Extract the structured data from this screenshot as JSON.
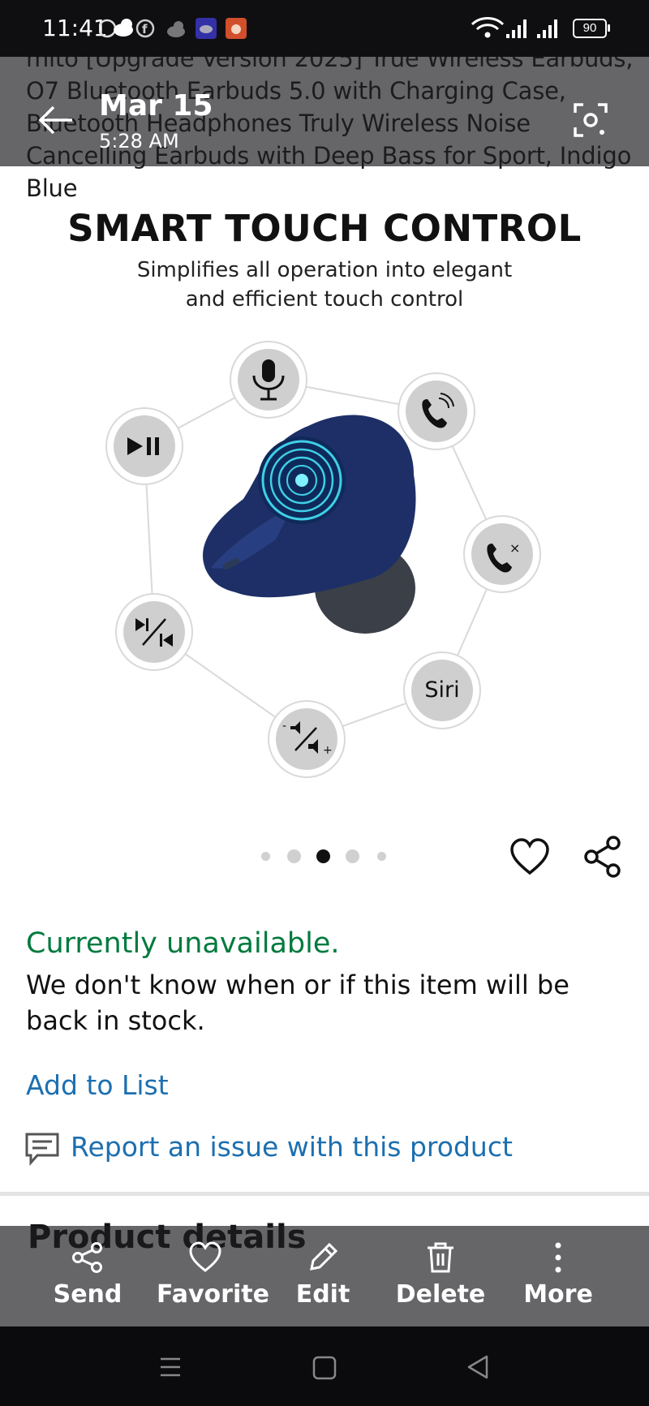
{
  "status_bar": {
    "time": "11:41",
    "battery": "90"
  },
  "viewer": {
    "date": "Mar 15",
    "time": "5:28 AM",
    "actions": [
      {
        "label": "Send",
        "icon": "share-icon"
      },
      {
        "label": "Favorite",
        "icon": "heart-icon"
      },
      {
        "label": "Edit",
        "icon": "pencil-icon"
      },
      {
        "label": "Delete",
        "icon": "trash-icon"
      },
      {
        "label": "More",
        "icon": "more-vertical-icon"
      }
    ]
  },
  "product": {
    "title": "mito [Upgrade Version 2025] True Wireless Earbuds, O7 Bluetooth Earbuds 5.0 with Charging Case, Bluetooth Headphones Truly Wireless Noise Cancelling Earbuds with Deep Bass for Sport, Indigo Blue",
    "image": {
      "headline": "SMART TOUCH CONTROL",
      "subtitle": "Simplifies all operation into elegant and efficient touch control",
      "siri_label": "Siri",
      "current_index": 3,
      "total": 5
    },
    "availability": "Currently unavailable.",
    "stock_message": "We don't know when or if this item will be back in stock.",
    "add_to_list": "Add to List",
    "report_issue": "Report an issue with this product",
    "details_heading": "Product details"
  },
  "colors": {
    "availability_green": "#007a3d",
    "link_blue": "#1c6fb0",
    "earbud_blue": "#1d2f66"
  }
}
